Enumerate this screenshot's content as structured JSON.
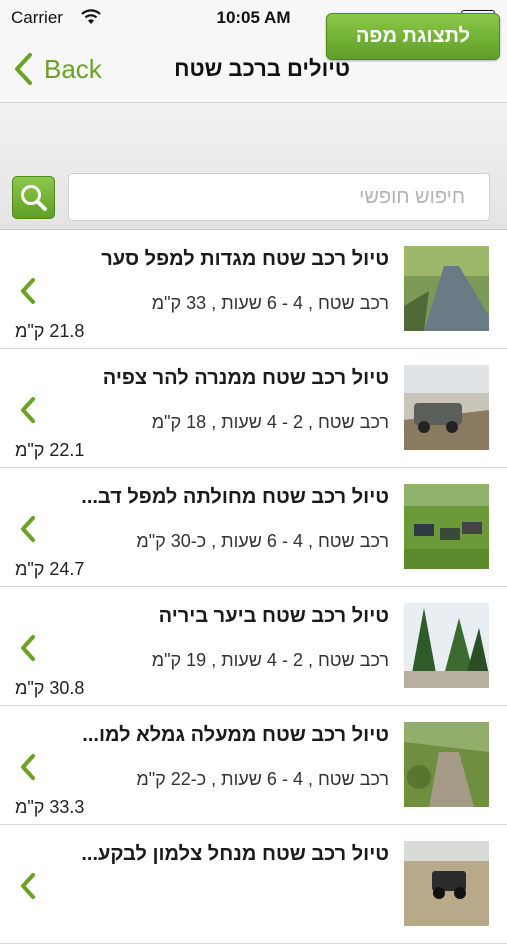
{
  "status_bar": {
    "carrier": "Carrier",
    "time": "10:05 AM"
  },
  "nav": {
    "back_label": "Back",
    "title": "טיולים ברכב שטח"
  },
  "toolbar": {
    "map_button_label": "לתצוגת מפה",
    "search_placeholder": "חיפוש חופשי"
  },
  "colors": {
    "accent": "#6aa323",
    "button_green": "#6aa82d"
  },
  "trips": [
    {
      "title": "טיול רכב שטח מגדות למפל סער",
      "subtitle": "רכב שטח , 4 - 6 שעות , 33 ק\"מ",
      "distance": "21.8 ק\"מ"
    },
    {
      "title": "טיול רכב שטח ממנרה להר צפיה",
      "subtitle": "רכב שטח , 2 - 4 שעות , 18 ק\"מ",
      "distance": "22.1 ק\"מ"
    },
    {
      "title": "טיול רכב שטח מחולתה למפל דב...",
      "subtitle": "רכב שטח , 4 - 6 שעות , כ-30 ק\"מ",
      "distance": "24.7 ק\"מ"
    },
    {
      "title": "טיול רכב שטח ביער ביריה",
      "subtitle": "רכב שטח , 2 - 4 שעות , 19 ק\"מ",
      "distance": "30.8 ק\"מ"
    },
    {
      "title": "טיול רכב שטח ממעלה גמלא למו...",
      "subtitle": "רכב שטח , 4 - 6 שעות , כ-22 ק\"מ",
      "distance": "33.3 ק\"מ"
    },
    {
      "title": "טיול רכב שטח מנחל צלמון לבקע...",
      "subtitle": "",
      "distance": ""
    }
  ]
}
